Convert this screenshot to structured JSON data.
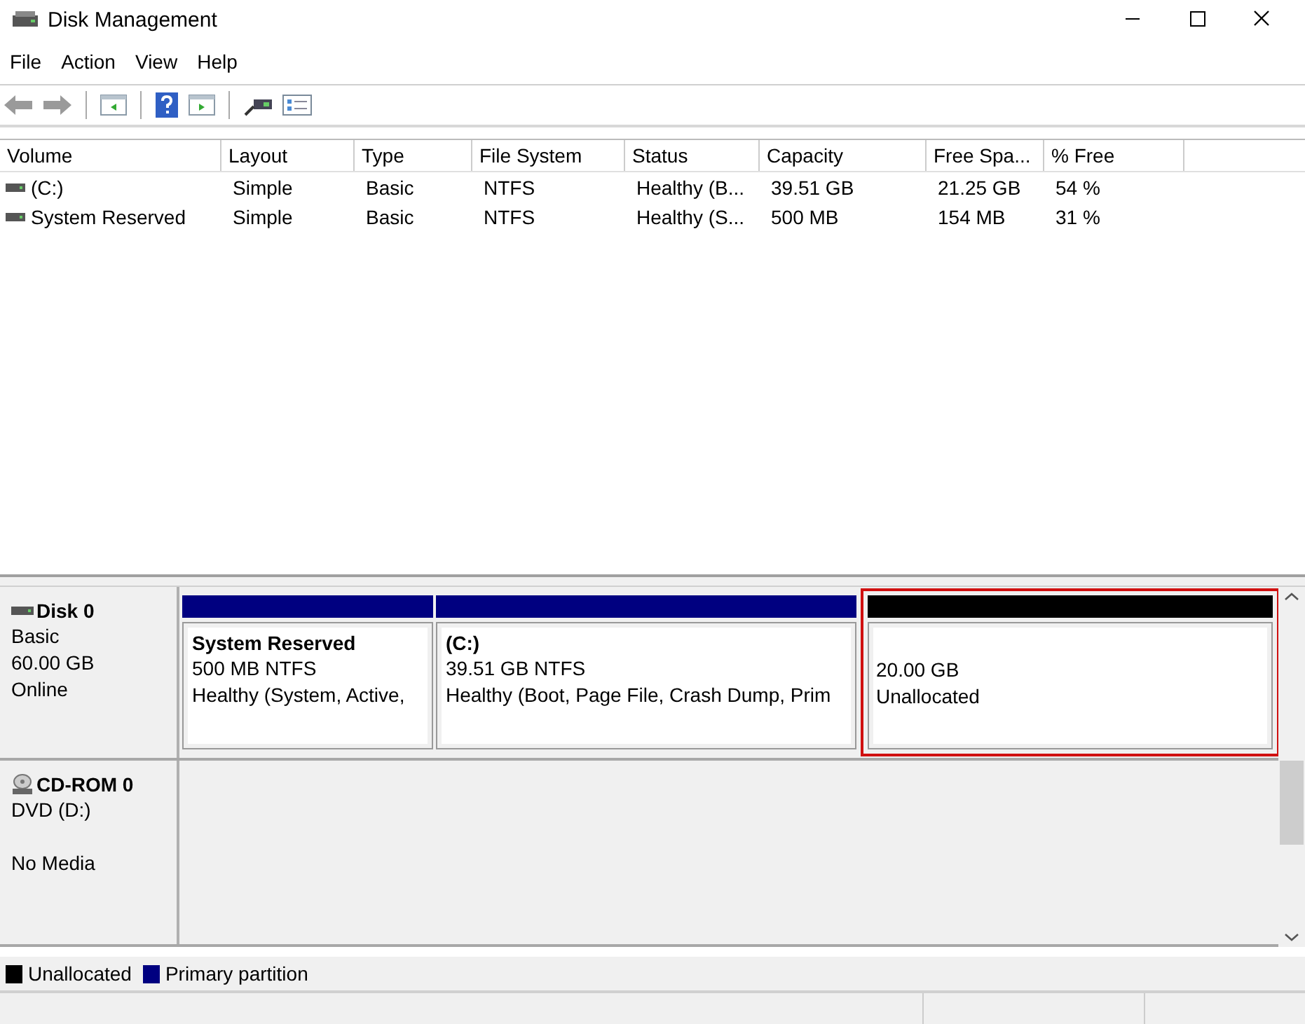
{
  "window": {
    "title": "Disk Management"
  },
  "menu": [
    "File",
    "Action",
    "View",
    "Help"
  ],
  "table": {
    "columns": [
      "Volume",
      "Layout",
      "Type",
      "File System",
      "Status",
      "Capacity",
      "Free Spa...",
      "% Free"
    ],
    "rows": [
      {
        "cells": [
          "(C:)",
          "Simple",
          "Basic",
          "NTFS",
          "Healthy (B...",
          "39.51 GB",
          "21.25 GB",
          "54 %"
        ]
      },
      {
        "cells": [
          "System Reserved",
          "Simple",
          "Basic",
          "NTFS",
          "Healthy (S...",
          "500 MB",
          "154 MB",
          "31 %"
        ]
      }
    ]
  },
  "disks": [
    {
      "kind": "disk",
      "name": "Disk 0",
      "lines": [
        "Basic",
        "60.00 GB",
        "Online"
      ],
      "partitions": [
        {
          "kind": "primary",
          "color": "#000080",
          "name": "System Reserved",
          "lines": [
            "500 MB NTFS",
            "Healthy (System, Active,"
          ],
          "highlighted": false
        },
        {
          "kind": "primary",
          "color": "#000080",
          "name": "(C:)",
          "lines": [
            "39.51 GB NTFS",
            "Healthy (Boot, Page File, Crash Dump, Prim"
          ],
          "highlighted": false
        },
        {
          "kind": "unallocated",
          "color": "#000000",
          "lines": [
            "20.00 GB",
            "Unallocated"
          ],
          "highlighted": true
        }
      ]
    },
    {
      "kind": "cdrom",
      "name": "CD-ROM 0",
      "lines": [
        "DVD (D:)",
        "No Media"
      ]
    }
  ],
  "legend": [
    {
      "label": "Unallocated",
      "color": "#000000"
    },
    {
      "label": "Primary partition",
      "color": "#000080"
    }
  ]
}
